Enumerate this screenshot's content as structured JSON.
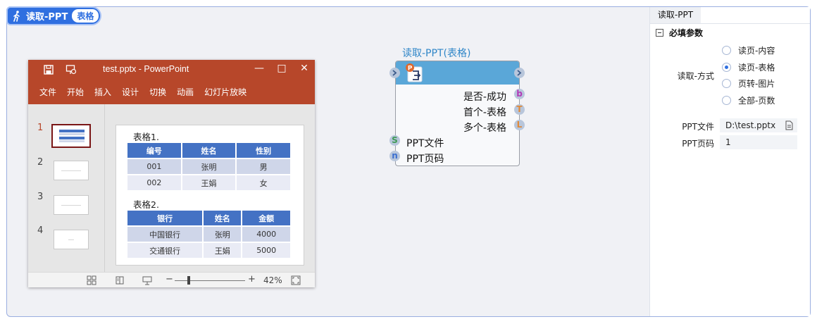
{
  "title_pill": {
    "label": "读取-PPT",
    "tag": "表格"
  },
  "ppt": {
    "window_title": "test.pptx  -  PowerPoint",
    "menu": [
      "文件",
      "开始",
      "插入",
      "设计",
      "切换",
      "动画",
      "幻灯片放映"
    ],
    "slides": [
      "1",
      "2",
      "3",
      "4"
    ],
    "table1": {
      "caption": "表格1.",
      "headers": [
        "编号",
        "姓名",
        "性别"
      ],
      "rows": [
        [
          "001",
          "张明",
          "男"
        ],
        [
          "002",
          "王娟",
          "女"
        ]
      ]
    },
    "table2": {
      "caption": "表格2.",
      "headers": [
        "银行",
        "姓名",
        "金额"
      ],
      "rows": [
        [
          "中国银行",
          "张明",
          "4000"
        ],
        [
          "交通银行",
          "王娟",
          "5000"
        ]
      ]
    },
    "status": {
      "zoom_minus": "−",
      "zoom_plus": "+",
      "zoom": "42%"
    }
  },
  "node": {
    "title": "读取-PPT(表格)",
    "outputs": [
      {
        "label": "是否-成功",
        "port": "b",
        "color": "#b23ab8"
      },
      {
        "label": "首个-表格",
        "port": "T",
        "color": "#e08a3a"
      },
      {
        "label": "多个-表格",
        "port": "L",
        "color": "#e08a3a"
      }
    ],
    "inputs": [
      {
        "label": "PPT文件",
        "port": "S",
        "color": "#3f9a55"
      },
      {
        "label": "PPT页码",
        "port": "n",
        "color": "#3b6fd0"
      }
    ]
  },
  "panel": {
    "tab": "读取-PPT",
    "section": "必填参数",
    "mode_label": "读取-方式",
    "options": [
      "读页-内容",
      "读页-表格",
      "页转-图片",
      "全部-页数"
    ],
    "selected_option": "读页-表格",
    "file_label": "PPT文件",
    "file_value": "D:\\test.pptx",
    "page_label": "PPT页码",
    "page_value": "1"
  }
}
